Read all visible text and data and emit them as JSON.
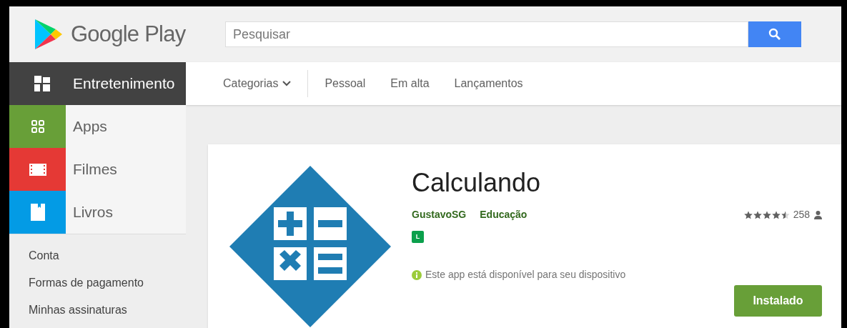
{
  "header": {
    "logo_text": "Google Play",
    "search": {
      "placeholder": "Pesquisar"
    }
  },
  "nav": {
    "section": "Entretenimento",
    "links": [
      {
        "label": "Categorias",
        "kind": "dropdown"
      },
      {
        "label": "Pessoal",
        "kind": "link"
      },
      {
        "label": "Em alta",
        "kind": "link"
      },
      {
        "label": "Lançamentos",
        "kind": "link"
      }
    ]
  },
  "sidebar": {
    "items": [
      {
        "label": "Apps",
        "kind": "apps",
        "color": "#689f38"
      },
      {
        "label": "Filmes",
        "kind": "movies",
        "color": "#e53935"
      },
      {
        "label": "Livros",
        "kind": "books",
        "color": "#039be5"
      }
    ],
    "links": [
      "Conta",
      "Formas de pagamento",
      "Minhas assinaturas"
    ]
  },
  "app": {
    "title": "Calculando",
    "developer": "GustavoSG",
    "category": "Educação",
    "content_rating": "L",
    "stars": 4.5,
    "rating_count": "258",
    "availability": "Este app está disponível para seu dispositivo",
    "install_button": "Instalado"
  }
}
